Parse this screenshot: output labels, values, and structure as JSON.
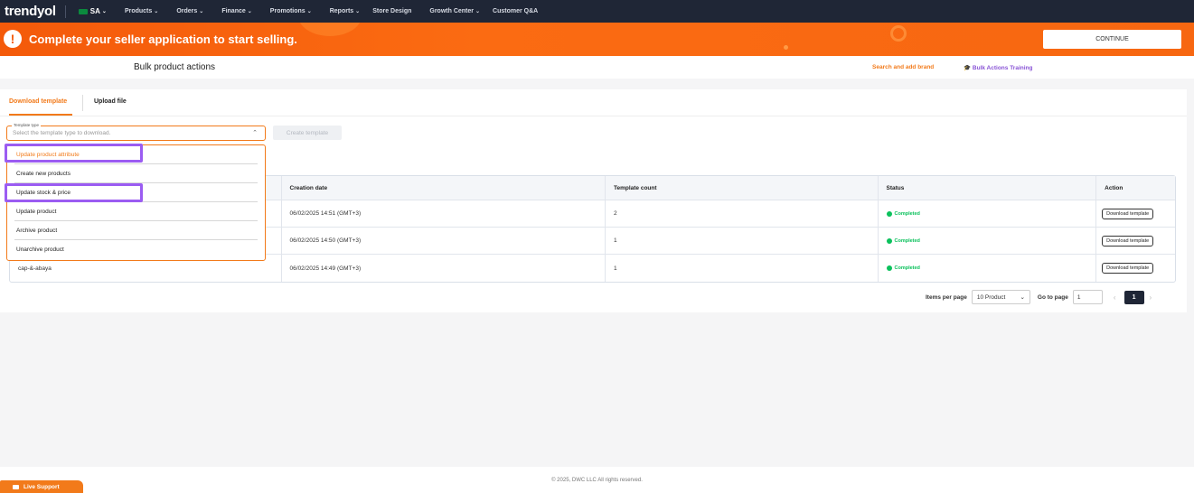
{
  "nav": {
    "logo": "trendyol",
    "region": "SA",
    "items": [
      "Products",
      "Orders",
      "Finance",
      "Promotions",
      "Reports",
      "Store Design",
      "Growth Center",
      "Customer Q&A"
    ]
  },
  "banner": {
    "message": "Complete your seller application to start selling.",
    "continue_label": "CONTINUE"
  },
  "header": {
    "title": "Bulk product actions",
    "search_brand_link": "Search and add brand",
    "training_link": "Bulk Actions Training"
  },
  "tabs": [
    "Download template",
    "Upload file"
  ],
  "form": {
    "select_label": "Template type",
    "select_placeholder": "Select the template type to download.",
    "create_button": "Create template"
  },
  "dropdown": {
    "options": [
      "Update product attribute",
      "Create new products",
      "Update stock & price",
      "Update product",
      "Archive product",
      "Unarchive product"
    ]
  },
  "table": {
    "headers": [
      "Creation date",
      "Template count",
      "Status",
      "Action"
    ],
    "rows": [
      {
        "name": "",
        "date": "06/02/2025 14:51 (GMT+3)",
        "count": "2",
        "status": "Completed",
        "action": "Download template"
      },
      {
        "name": "",
        "date": "06/02/2025 14:50 (GMT+3)",
        "count": "1",
        "status": "Completed",
        "action": "Download template"
      },
      {
        "name": "cap-&-abaya",
        "date": "06/02/2025 14:49 (GMT+3)",
        "count": "1",
        "status": "Completed",
        "action": "Download template"
      }
    ]
  },
  "pagination": {
    "items_per_page_label": "Items per page",
    "items_per_page_value": "10 Product",
    "goto_label": "Go to page",
    "goto_value": "1",
    "current_page": "1"
  },
  "footer": {
    "copyright": "© 2025, DWC LLC All rights reserved.",
    "live_support": "Live Support"
  },
  "colors": {
    "accent": "#f27a1a",
    "nav_bg": "#1f2636",
    "highlight": "#9b5cf2",
    "status_green": "#0bc15c"
  }
}
